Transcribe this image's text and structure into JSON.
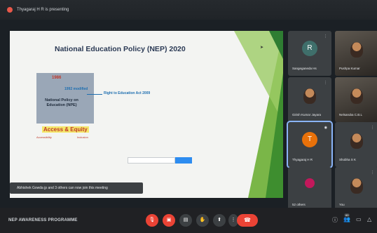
{
  "header": {
    "presenting_text": "Thyagaraj H R is presenting"
  },
  "slide": {
    "title": "National Education Policy (NEP) 2020",
    "year_1986": "1986",
    "modified": "1992 modified",
    "npe_label": "National Policy on Education (NPE)",
    "rte_label": "Right to Education Act 2009",
    "access_equity": "Access & Equity",
    "sub_left": "Accessibility",
    "sub_right": "Inclusion"
  },
  "toast": {
    "text": "Abhishek Gowda jp and 3 others can now join this meeting"
  },
  "participants": [
    {
      "name": "Sangeganeda Hs",
      "initial": "R",
      "avatar_color": "#3f6f6b",
      "kind": "avatar"
    },
    {
      "name": "Pushpa Kumar",
      "kind": "photo"
    },
    {
      "name": "Girish Kumar Jayara",
      "kind": "photo"
    },
    {
      "name": "Nelsaruba C.B.L",
      "kind": "photo"
    },
    {
      "name": "Thyagaraj H R",
      "initial": "T",
      "avatar_color": "#e8710a",
      "kind": "avatar",
      "active": true
    },
    {
      "name": "Shobha S K",
      "kind": "photo"
    },
    {
      "name": "52 others",
      "kind": "others"
    },
    {
      "name": "You",
      "kind": "photo"
    }
  ],
  "bottom": {
    "program_label": "NEP AWARENESS PROGRAMME",
    "participant_count": "60"
  },
  "colors": {
    "accent": "#8ab4f8",
    "danger": "#ea4335",
    "bg": "#1b2025"
  }
}
